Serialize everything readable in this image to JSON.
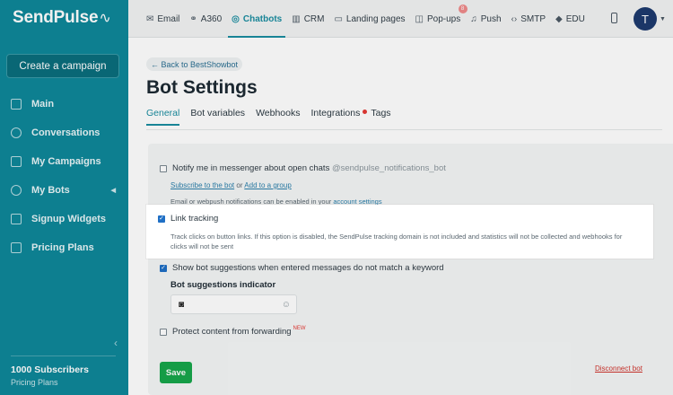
{
  "sidebar": {
    "logo": "SendPulse",
    "create_campaign": "Create a campaign",
    "items": [
      {
        "label": "Main"
      },
      {
        "label": "Conversations"
      },
      {
        "label": "My Campaigns"
      },
      {
        "label": "My Bots"
      },
      {
        "label": "Signup Widgets"
      },
      {
        "label": "Pricing Plans"
      }
    ],
    "subscribers": "1000 Subscribers",
    "pricing_plans": "Pricing Plans"
  },
  "topnav": {
    "items": [
      {
        "label": "Email",
        "icon": "envelope-icon"
      },
      {
        "label": "A360",
        "icon": "a360-icon"
      },
      {
        "label": "Chatbots",
        "icon": "chat-icon",
        "active": true
      },
      {
        "label": "CRM",
        "icon": "crm-icon"
      },
      {
        "label": "Landing pages",
        "icon": "landing-icon"
      },
      {
        "label": "Pop-ups",
        "icon": "popup-icon"
      },
      {
        "label": "Push",
        "icon": "bell-icon"
      },
      {
        "label": "SMTP",
        "icon": "code-icon"
      },
      {
        "label": "EDU",
        "icon": "graduation-icon"
      }
    ],
    "popups_badge": "8",
    "avatar_letter": "T"
  },
  "main": {
    "back_link": "← Back to BestShowbot",
    "title": "Bot Settings",
    "tabs": [
      {
        "label": "General"
      },
      {
        "label": "Bot variables"
      },
      {
        "label": "Webhooks"
      },
      {
        "label": "Integrations"
      },
      {
        "label": "Tags"
      }
    ],
    "notify_label": "Notify me in messenger about open chats",
    "notify_bot": "@sendpulse_notifications_bot",
    "subscribe_link": "Subscribe to the bot",
    "or_text": "or",
    "add_group_link": "Add to a group",
    "notify_hint": "Email or webpush notifications can be enabled in your",
    "account_settings_link": "account settings",
    "link_tracking_label": "Link tracking",
    "link_tracking_desc": "Track clicks on button links. If this option is disabled, the SendPulse tracking domain is not included and statistics will not be collected and webhooks for clicks will not be sent",
    "suggestions_label": "Show bot suggestions when entered messages do not match a keyword",
    "suggestions_indicator_label": "Bot suggestions indicator",
    "protect_label": "Protect content from forwarding",
    "new_badge": "NEW",
    "save_button": "Save",
    "disconnect_link": "Disconnect bot"
  },
  "colors": {
    "sidebar": "#0e8799",
    "accent": "#1a8da0",
    "save": "#17a64b",
    "danger": "#d0342c"
  }
}
